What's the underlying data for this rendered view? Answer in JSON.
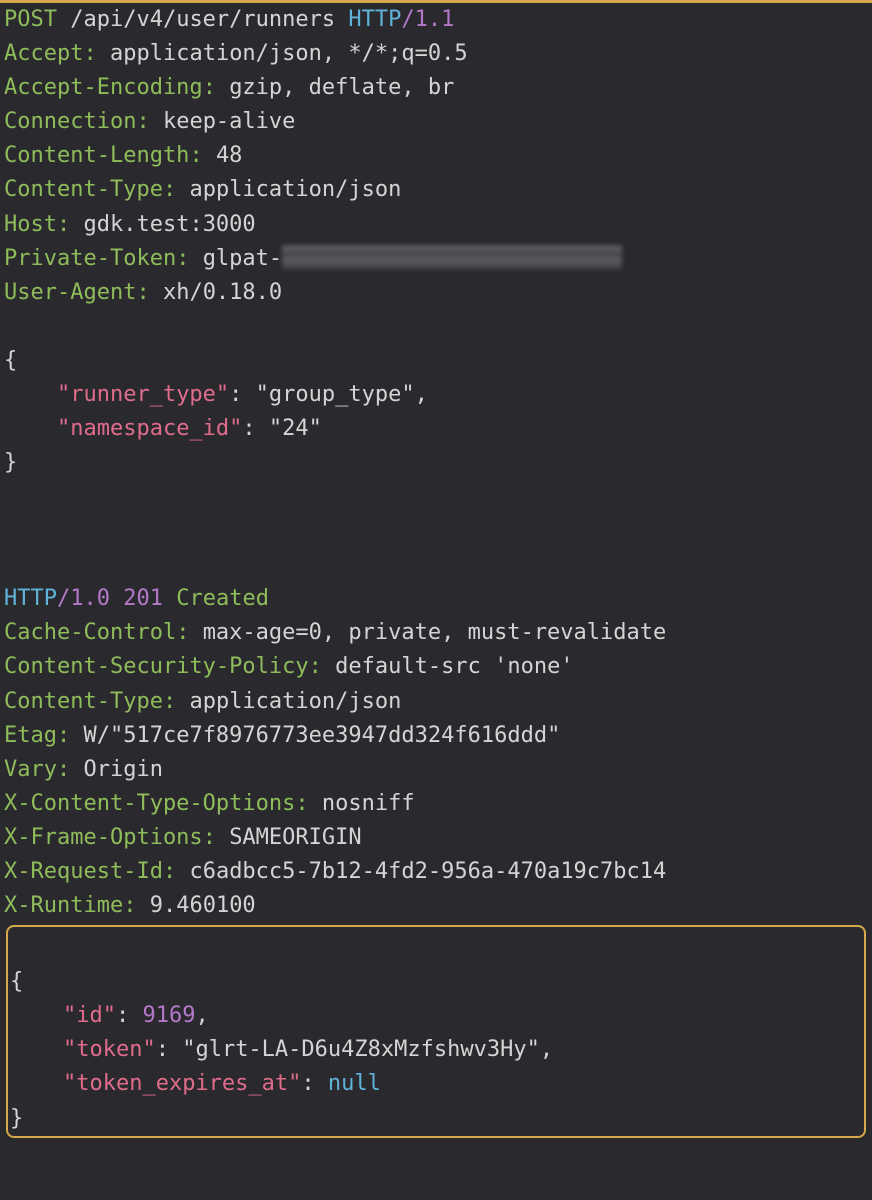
{
  "request": {
    "method": "POST",
    "path": "/api/v4/user/runners",
    "protocol": "HTTP",
    "version": "1.1",
    "headers": [
      {
        "name": "Accept",
        "value": "application/json, */*;q=0.5"
      },
      {
        "name": "Accept-Encoding",
        "value": "gzip, deflate, br"
      },
      {
        "name": "Connection",
        "value": "keep-alive"
      },
      {
        "name": "Content-Length",
        "value": "48"
      },
      {
        "name": "Content-Type",
        "value": "application/json"
      },
      {
        "name": "Host",
        "value": "gdk.test:3000"
      },
      {
        "name": "Private-Token",
        "value": "glpat-",
        "redacted": true
      },
      {
        "name": "User-Agent",
        "value": "xh/0.18.0"
      }
    ],
    "body": {
      "runner_type": "group_type",
      "namespace_id": "24"
    }
  },
  "response": {
    "protocol": "HTTP",
    "version": "1.0",
    "status_code": "201",
    "status_text": "Created",
    "headers": [
      {
        "name": "Cache-Control",
        "value": "max-age=0, private, must-revalidate"
      },
      {
        "name": "Content-Security-Policy",
        "value": "default-src 'none'"
      },
      {
        "name": "Content-Type",
        "value": "application/json"
      },
      {
        "name": "Etag",
        "value": "W/\"517ce7f8976773ee3947dd324f616ddd\""
      },
      {
        "name": "Vary",
        "value": "Origin"
      },
      {
        "name": "X-Content-Type-Options",
        "value": "nosniff"
      },
      {
        "name": "X-Frame-Options",
        "value": "SAMEORIGIN"
      },
      {
        "name": "X-Request-Id",
        "value": "c6adbcc5-7b12-4fd2-956a-470a19c7bc14"
      },
      {
        "name": "X-Runtime",
        "value": "9.460100"
      }
    ],
    "body": {
      "id": 9169,
      "token": "glrt-LA-D6u4Z8xMzfshwv3Hy",
      "token_expires_at": null
    }
  },
  "glyphs": {
    "colon_space": ": ",
    "slash": "/",
    "space": " ",
    "open_brace": "{",
    "close_brace": "}",
    "quote": "\"",
    "comma": ",",
    "null": "null"
  }
}
